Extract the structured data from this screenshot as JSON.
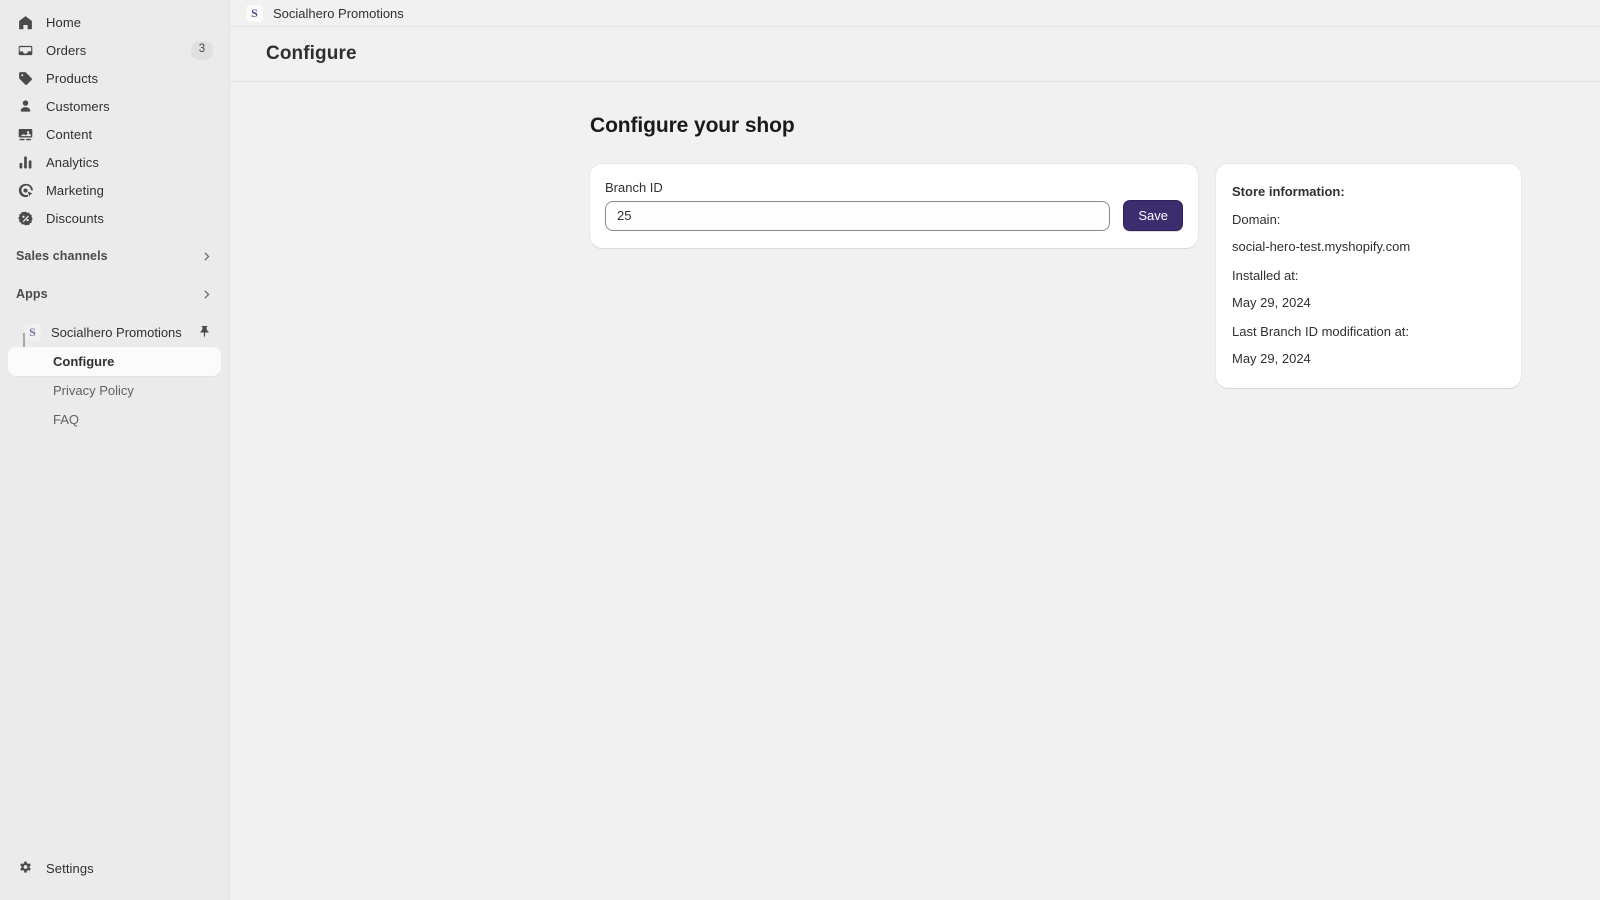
{
  "sidebar": {
    "primary_items": [
      {
        "label": "Home",
        "icon": "home-icon",
        "badge": null
      },
      {
        "label": "Orders",
        "icon": "orders-inbox-icon",
        "badge": "3"
      },
      {
        "label": "Products",
        "icon": "product-tag-icon",
        "badge": null
      },
      {
        "label": "Customers",
        "icon": "customer-person-icon",
        "badge": null
      },
      {
        "label": "Content",
        "icon": "content-image-icon",
        "badge": null
      },
      {
        "label": "Analytics",
        "icon": "analytics-bars-icon",
        "badge": null
      },
      {
        "label": "Marketing",
        "icon": "marketing-target-icon",
        "badge": null
      },
      {
        "label": "Discounts",
        "icon": "discount-percent-icon",
        "badge": null
      }
    ],
    "sales_channels": {
      "label": "Sales channels"
    },
    "apps": {
      "label": "Apps"
    },
    "app_entry": {
      "label": "Socialhero Promotions",
      "logo_letter": "S"
    },
    "sub_items": [
      {
        "label": "Configure",
        "active": true
      },
      {
        "label": "Privacy Policy",
        "active": false
      },
      {
        "label": "FAQ",
        "active": false
      }
    ],
    "footer": {
      "label": "Settings",
      "icon": "gear-icon"
    }
  },
  "topbar": {
    "app_logo_letter": "S",
    "title": "Socialhero Promotions"
  },
  "page": {
    "title": "Configure"
  },
  "main": {
    "heading": "Configure your shop",
    "form": {
      "field_label": "Branch ID",
      "field_value": "25",
      "field_placeholder": "Branch ID",
      "save_label": "Save"
    },
    "store_info": {
      "title": "Store information:",
      "domain_label": "Domain:",
      "domain_value": "social-hero-test.myshopify.com",
      "installed_label": "Installed at:",
      "installed_value": "May 29, 2024",
      "modified_label": "Last Branch ID modification at:",
      "modified_value": "May 29, 2024"
    }
  },
  "colors": {
    "accent": "#3b2d6e",
    "sidebar_bg": "#ebebeb",
    "content_bg": "#f1f1f1",
    "card_bg": "#ffffff",
    "logo_purple": "#5c4b8f"
  }
}
